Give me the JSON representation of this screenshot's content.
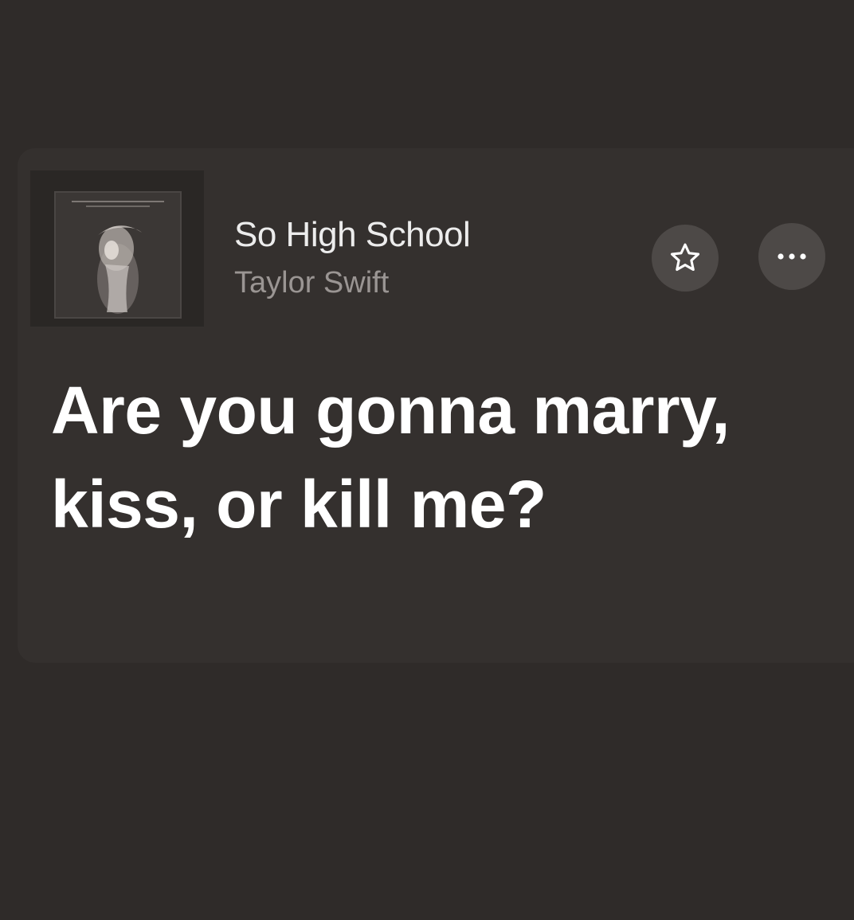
{
  "song": {
    "title": "So High School",
    "artist": "Taylor Swift"
  },
  "actions": {
    "favorite_icon": "star-icon",
    "more_icon": "ellipsis-icon"
  },
  "lyric": {
    "text": "Are you gonna marry, kiss, or kill me?"
  },
  "colors": {
    "background": "#2f2b29",
    "card": "#34302e",
    "button": "#4d4947",
    "title": "#ececec",
    "artist": "#9a9593",
    "lyric": "#ffffff"
  }
}
